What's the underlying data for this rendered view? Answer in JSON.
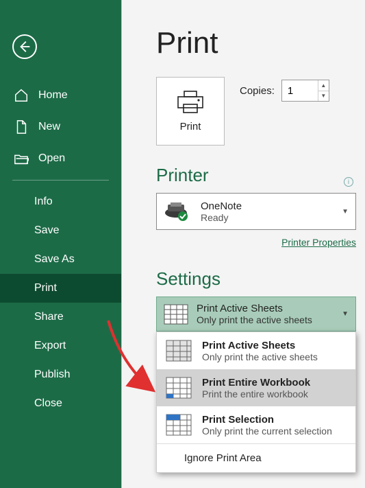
{
  "sidebar": {
    "back": "Back",
    "items": [
      {
        "label": "Home"
      },
      {
        "label": "New"
      },
      {
        "label": "Open"
      },
      {
        "label": "Info"
      },
      {
        "label": "Save"
      },
      {
        "label": "Save As"
      },
      {
        "label": "Print"
      },
      {
        "label": "Share"
      },
      {
        "label": "Export"
      },
      {
        "label": "Publish"
      },
      {
        "label": "Close"
      }
    ]
  },
  "page": {
    "title": "Print",
    "print_button": "Print",
    "copies_label": "Copies:",
    "copies_value": "1"
  },
  "printer": {
    "heading": "Printer",
    "selected_name": "OneNote",
    "selected_status": "Ready",
    "properties_link": "Printer Properties"
  },
  "settings": {
    "heading": "Settings",
    "current": {
      "title": "Print Active Sheets",
      "subtitle": "Only print the active sheets"
    },
    "options": [
      {
        "title": "Print Active Sheets",
        "subtitle": "Only print the active sheets"
      },
      {
        "title": "Print Entire Workbook",
        "subtitle": "Print the entire workbook"
      },
      {
        "title": "Print Selection",
        "subtitle": "Only print the current selection"
      }
    ],
    "ignore_label": "Ignore Print Area"
  }
}
